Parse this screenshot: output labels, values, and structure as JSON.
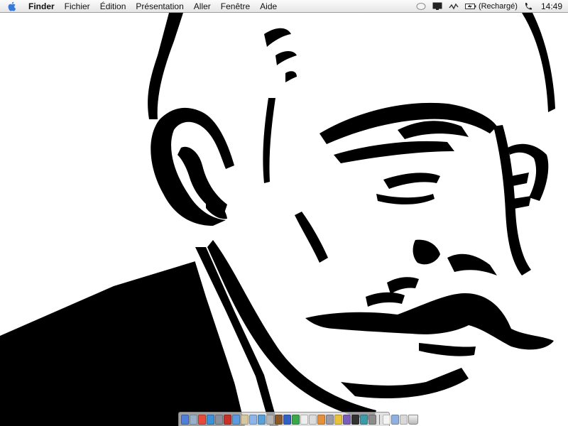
{
  "menubar": {
    "apple_icon": "apple-icon",
    "app_name": "Finder",
    "menus": [
      "Fichier",
      "Édition",
      "Présentation",
      "Aller",
      "Fenêtre",
      "Aide"
    ],
    "extras": {
      "spotlight_icon": "spotlight-icon",
      "display_icon": "display-icon",
      "network_icon": "network-activity-icon",
      "battery_icon": "battery-icon",
      "battery_status": "(Rechargé)",
      "phone_icon": "phone-icon"
    },
    "clock": "14:49"
  },
  "wallpaper": {
    "description_icon": "portrait-illustration",
    "colors": {
      "ink": "#000000",
      "paper": "#ffffff"
    }
  },
  "dock": {
    "icons": [
      {
        "name": "finder",
        "color": "#4f7fd8"
      },
      {
        "name": "mail",
        "color": "#9ab0c8"
      },
      {
        "name": "ical",
        "color": "#e64a3c"
      },
      {
        "name": "safari",
        "color": "#3d8fd6"
      },
      {
        "name": "network",
        "color": "#8a8f9a"
      },
      {
        "name": "red-app",
        "color": "#c8302a"
      },
      {
        "name": "ichat",
        "color": "#5c9be0"
      },
      {
        "name": "address-book",
        "color": "#d7c7a0"
      },
      {
        "name": "itunes",
        "color": "#8fb4e8"
      },
      {
        "name": "iphoto",
        "color": "#5aa0d8"
      },
      {
        "name": "preview",
        "color": "#b5b5b5"
      },
      {
        "name": "brown-app",
        "color": "#8a5a2c"
      },
      {
        "name": "blue-app",
        "color": "#2f62c4"
      },
      {
        "name": "green-app",
        "color": "#3aa84a"
      },
      {
        "name": "white-app",
        "color": "#eeeeee"
      },
      {
        "name": "clock-app",
        "color": "#dcdcdc"
      },
      {
        "name": "orange-app",
        "color": "#e6903a"
      },
      {
        "name": "system-prefs",
        "color": "#9a9aa8"
      },
      {
        "name": "yellow-app",
        "color": "#e9c23c"
      },
      {
        "name": "purple-app",
        "color": "#7a5fb8"
      },
      {
        "name": "terminal",
        "color": "#333333"
      },
      {
        "name": "teal-app",
        "color": "#3d9aa8"
      },
      {
        "name": "gray-app",
        "color": "#8c8c8c"
      }
    ],
    "docs": [
      {
        "name": "document",
        "color": "#f4f4f4"
      },
      {
        "name": "folder",
        "color": "#8fb0e0"
      },
      {
        "name": "window",
        "color": "#d8d8d8"
      }
    ],
    "trash_icon": "trash-icon"
  }
}
